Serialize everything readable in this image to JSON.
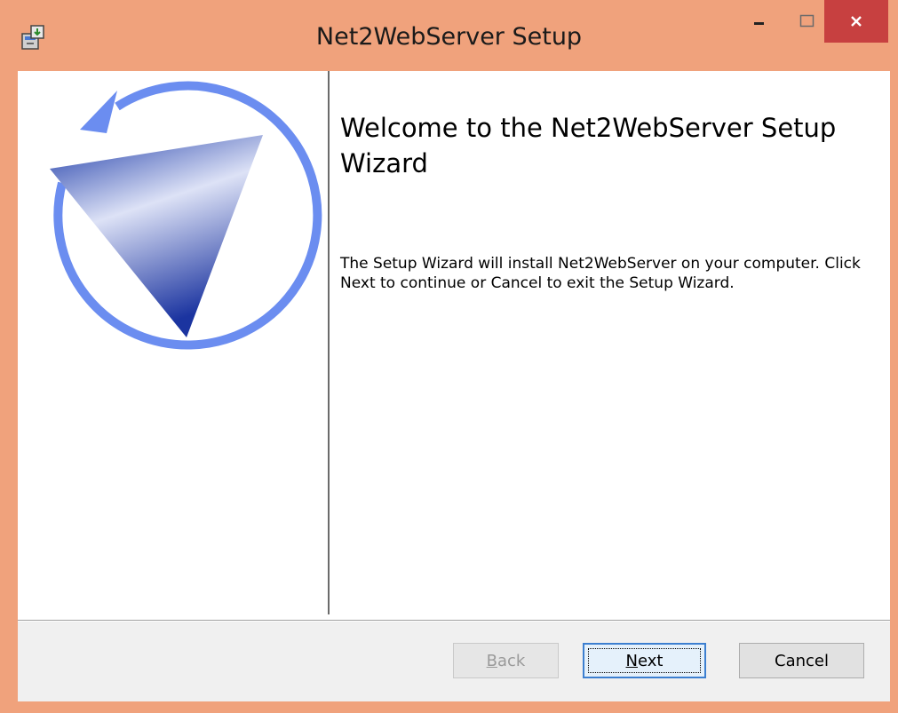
{
  "window": {
    "title": "Net2WebServer Setup"
  },
  "colors": {
    "titlebar": "#f0a27c",
    "close_button": "#c74040",
    "logo_blue": "#6b8df0",
    "logo_dark": "#1b3aa8"
  },
  "icons": {
    "app": "installer-icon",
    "minimize": "minimize-icon",
    "maximize": "maximize-icon",
    "close": "close-icon",
    "logo": "net2-logo"
  },
  "content": {
    "heading": "Welcome to the Net2WebServer Setup Wizard",
    "description": "The Setup Wizard will install Net2WebServer on your computer. Click Next to continue or Cancel to exit the Setup Wizard."
  },
  "buttons": {
    "back_prefix": "",
    "back_key": "B",
    "back_rest": "ack",
    "next_prefix": "",
    "next_key": "N",
    "next_rest": "ext",
    "cancel": "Cancel"
  }
}
